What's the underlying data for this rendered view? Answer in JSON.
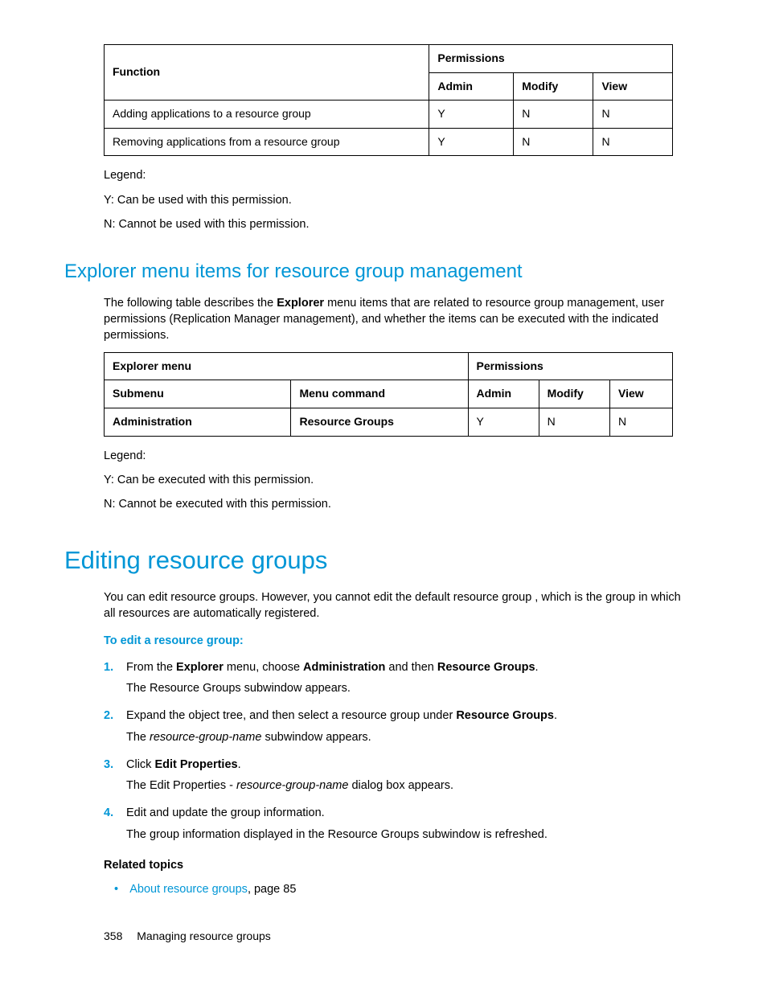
{
  "table1": {
    "h_function": "Function",
    "h_permissions": "Permissions",
    "h_admin": "Admin",
    "h_modify": "Modify",
    "h_view": "View",
    "rows": [
      {
        "fn": "Adding applications to a resource group",
        "a": "Y",
        "m": "N",
        "v": "N"
      },
      {
        "fn": "Removing applications from a resource group",
        "a": "Y",
        "m": "N",
        "v": "N"
      }
    ]
  },
  "legend1": {
    "title": "Legend:",
    "y": "Y: Can be used with this permission.",
    "n": "N: Cannot be used with this permission."
  },
  "section_explorer": {
    "heading": "Explorer menu items for resource group management",
    "intro_pre": "The following table describes the ",
    "intro_bold": "Explorer",
    "intro_post": " menu items that are related to resource group management, user permissions (Replication Manager management), and whether the items can be executed with the indicated permissions."
  },
  "table2": {
    "h_menu": "Explorer menu",
    "h_permissions": "Permissions",
    "h_submenu": "Submenu",
    "h_command": "Menu command",
    "h_admin": "Admin",
    "h_modify": "Modify",
    "h_view": "View",
    "row": {
      "sub": "Administration",
      "cmd": "Resource Groups",
      "a": "Y",
      "m": "N",
      "v": "N"
    }
  },
  "legend2": {
    "title": "Legend:",
    "y": "Y: Can be executed with this permission.",
    "n": "N: Cannot be executed with this permission."
  },
  "editing": {
    "heading": "Editing resource groups",
    "intro": "You can edit resource groups. However, you cannot edit the default resource group                                , which is the group in which all resources are automatically registered.",
    "sub": "To edit a resource group:",
    "steps": [
      {
        "num": "1.",
        "main_parts": [
          "From the ",
          "Explorer",
          " menu, choose ",
          "Administration",
          " and then ",
          "Resource Groups",
          "."
        ],
        "sub": "The Resource Groups subwindow appears."
      },
      {
        "num": "2.",
        "main_parts": [
          "Expand the object tree, and then select a resource group under ",
          "Resource Groups",
          "."
        ],
        "sub_parts": [
          "The ",
          "resource-group-name",
          " subwindow appears."
        ]
      },
      {
        "num": "3.",
        "main_parts": [
          "Click ",
          "Edit Properties",
          "."
        ],
        "sub_parts": [
          "The Edit Properties - ",
          "resource-group-name",
          " dialog box appears."
        ]
      },
      {
        "num": "4.",
        "main_parts": [
          "Edit and update the group information."
        ],
        "sub": "The group information displayed in the Resource Groups subwindow is refreshed."
      }
    ],
    "related_h": "Related topics",
    "related": {
      "link": "About resource groups",
      "rest": ", page 85"
    }
  },
  "footer": {
    "page": "358",
    "title": "Managing resource groups"
  }
}
